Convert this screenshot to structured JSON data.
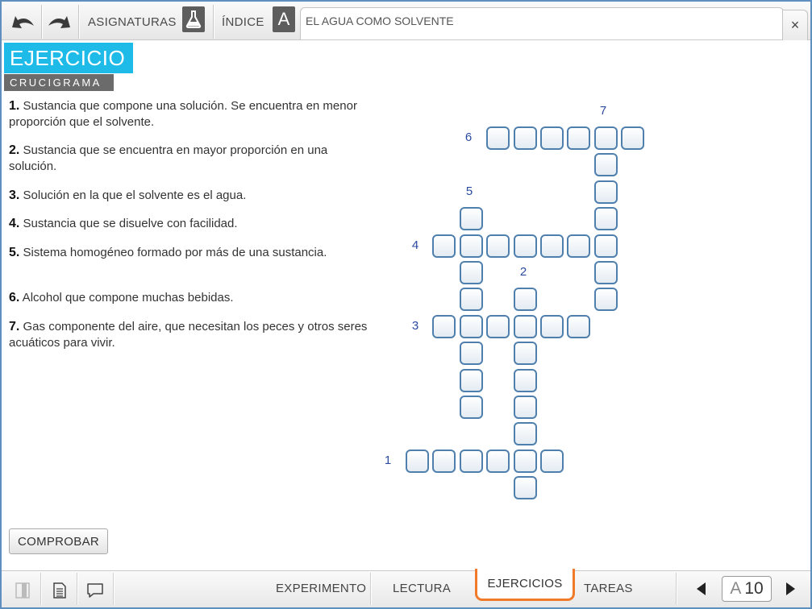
{
  "toolbar": {
    "subjects_label": "ASIGNATURAS",
    "index_label": "ÍNDICE",
    "index_letter": "A",
    "document_title": "EL AGUA COMO SOLVENTE",
    "close_glyph": "×"
  },
  "exercise": {
    "title": "EJERCICIO",
    "subtitle": "CRUCIGRAMA",
    "clues": [
      {
        "num": "1.",
        "text": " Sustancia que compone una solución. Se encuentra en menor proporción que el solvente."
      },
      {
        "num": "2.",
        "text": " Sustancia que se encuentra en mayor proporción en una solución."
      },
      {
        "num": "3.",
        "text": " Solución en la que el solvente es el agua."
      },
      {
        "num": "4.",
        "text": " Sustancia que se disuelve con facilidad."
      },
      {
        "num": "5.",
        "text": " Sistema homogéneo formado por más de una sustancia."
      },
      {
        "num": "6.",
        "text": " Alcohol que compone muchas bebidas."
      },
      {
        "num": "7.",
        "text": " Gas componente del aire, que necesitan los peces y otros seres acuáticos para vivir."
      }
    ],
    "crossword_numbers": [
      "1",
      "2",
      "3",
      "4",
      "5",
      "6",
      "7"
    ],
    "check_button": "COMPROBAR"
  },
  "bottom_nav": {
    "tabs": [
      "EXPERIMENTO",
      "LECTURA",
      "EJERCICIOS",
      "TAREAS"
    ],
    "active_tab": "EJERCICIOS",
    "page_letter": "A",
    "page_number": "10"
  },
  "colors": {
    "accent": "#1ebbe9",
    "active_tab_border": "#f07a2a",
    "cell_border": "#4f80ad",
    "number_color": "#2b4aa0"
  }
}
